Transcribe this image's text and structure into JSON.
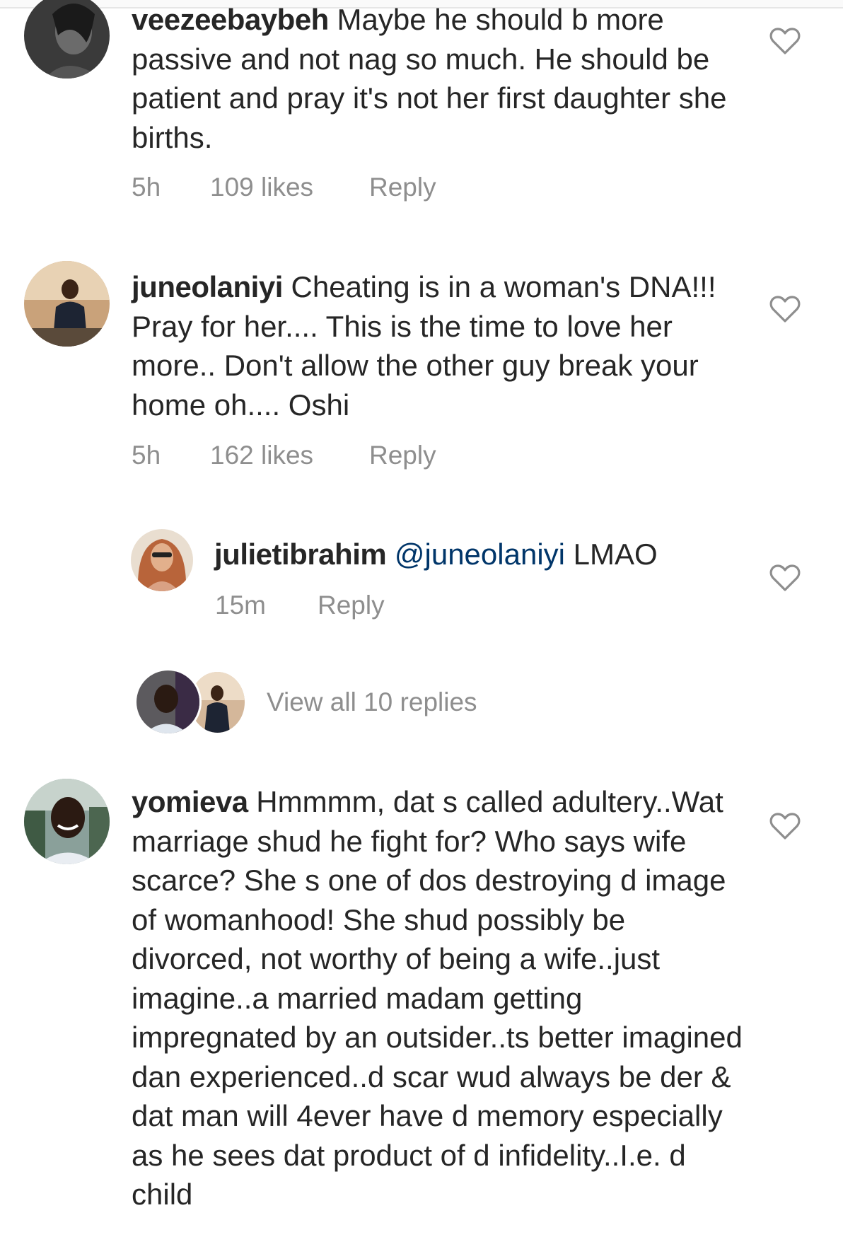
{
  "comments": [
    {
      "username": "veezeebaybeh",
      "text": "Maybe he should b more passive and not nag so much. He should be patient and pray it's not her first daughter she births.",
      "time": "5h",
      "likes": "109 likes",
      "reply_label": "Reply"
    },
    {
      "username": "juneolaniyi",
      "text": "Cheating is in a woman's DNA!!! Pray for her.... This is the time to love her more.. Don't allow the other guy break your home oh.... Oshi",
      "time": "5h",
      "likes": "162 likes",
      "reply_label": "Reply"
    },
    {
      "username": "yomieva",
      "text": "Hmmmm, dat s called adultery..Wat marriage shud he fight for? Who says wife scarce? She s one of dos destroying d image of womanhood! She shud possibly be divorced, not worthy of being a wife..just imagine..a married madam getting impregnated by an outsider..ts better imagined dan experienced..d scar wud always be der & dat man will 4ever have d memory especially as he sees dat product of d infidelity..I.e. d child"
    }
  ],
  "reply": {
    "username": "julietibrahim",
    "mention": "@juneolaniyi",
    "text": "LMAO",
    "time": "15m",
    "reply_label": "Reply"
  },
  "view_replies": "View all 10 replies",
  "colors": {
    "text": "#262626",
    "secondary": "#8e8e8e",
    "mention": "#003569",
    "heart_stroke": "#8e8e8e"
  },
  "icons": [
    "heart-outline-icon"
  ]
}
